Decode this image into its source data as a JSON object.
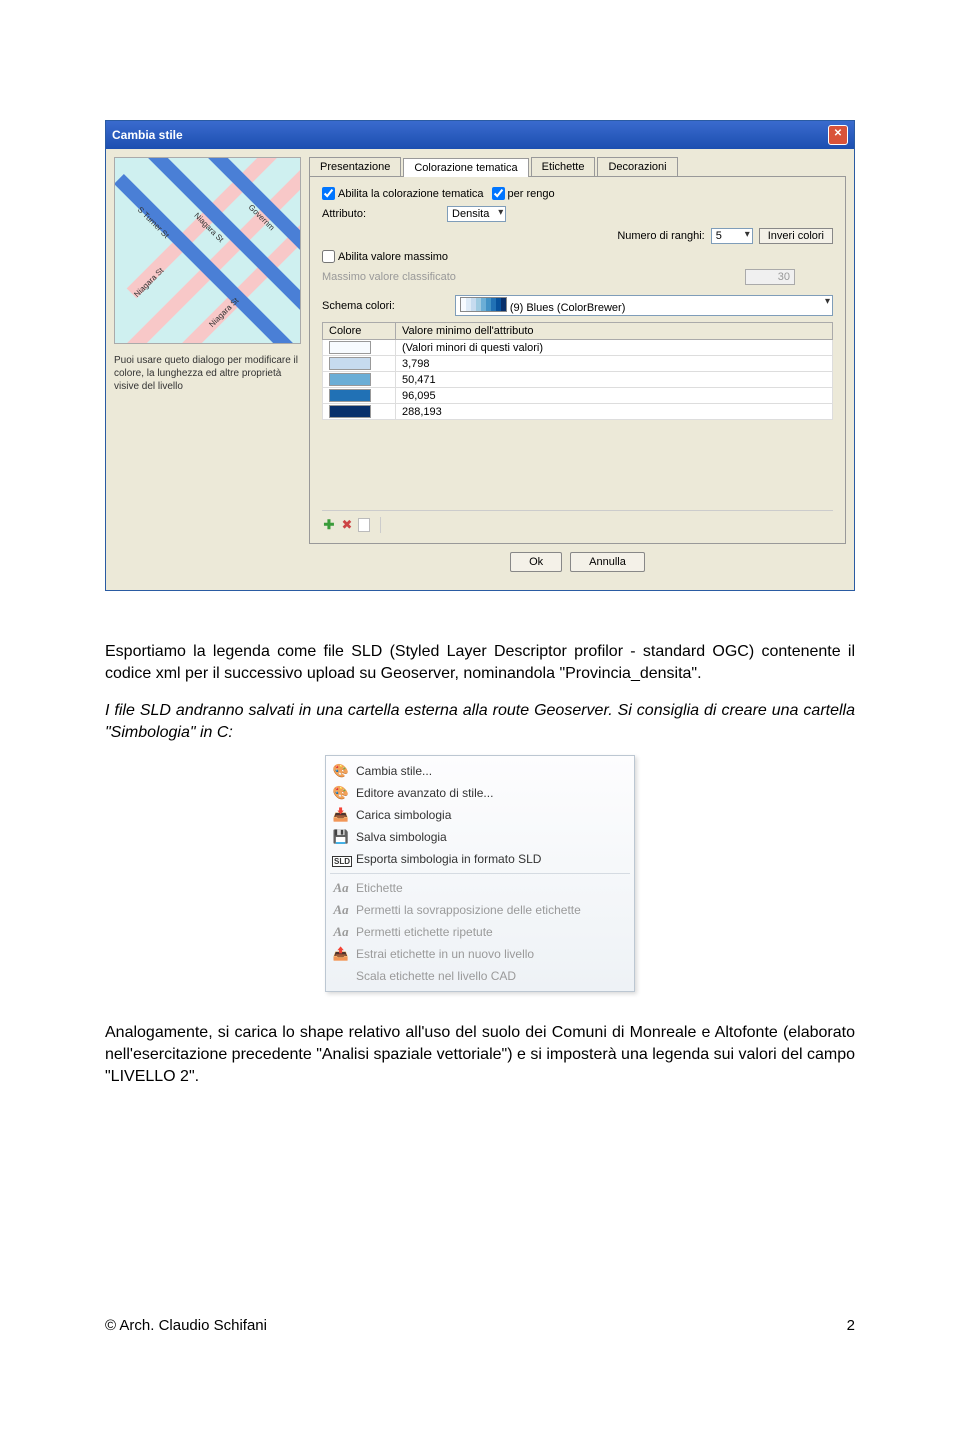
{
  "dialog": {
    "title": "Cambia stile",
    "help": "Puoi usare queto dialogo per modificare il colore, la lunghezza ed altre proprietà visive del livello",
    "tabs": [
      "Presentazione",
      "Colorazione tematica",
      "Etichette",
      "Decorazioni"
    ],
    "active_tab": 1,
    "enable_thematic": "Abilita la colorazione tematica",
    "per_range": "per rengo",
    "attr_label": "Attributo:",
    "attr_value": "Densita",
    "num_ranks_label": "Numero di ranghi:",
    "num_ranks_value": "5",
    "invert_colors": "Inveri colori",
    "enable_max": "Abilita valore massimo",
    "max_label": "Massimo valore classificato",
    "max_value": "30",
    "scheme_label": "Schema colori:",
    "scheme_value": "(9) Blues (ColorBrewer)",
    "col_header_color": "Colore",
    "col_header_min": "Valore minimo dell'attributo",
    "rows": [
      {
        "swatch": "#f7fbff",
        "label": "(Valori minori di questi valori)"
      },
      {
        "swatch": "#c6dbef",
        "label": "3,798"
      },
      {
        "swatch": "#6baed6",
        "label": "50,471"
      },
      {
        "swatch": "#2171b5",
        "label": "96,095"
      },
      {
        "swatch": "#08306b",
        "label": "288,193"
      }
    ],
    "ok": "Ok",
    "cancel": "Annulla",
    "map_labels": [
      "S Turner St",
      "Niagara St",
      "Governm"
    ]
  },
  "para1": "Esportiamo la legenda come file SLD (Styled Layer Descriptor profilor - standard OGC) contenente il codice xml per il successivo upload su Geoserver, nominandola \"Provincia_densita\".",
  "para2": "I file SLD andranno salvati in una cartella esterna alla route Geoserver. Si consiglia di creare una cartella \"Simbologia\" in C:",
  "menu": {
    "items": [
      {
        "icon": "🎨",
        "label": "Cambia stile...",
        "disabled": false
      },
      {
        "icon": "🎨",
        "label": "Editore avanzato di stile...",
        "disabled": false
      },
      {
        "icon": "📥",
        "label": "Carica simbologia",
        "disabled": false
      },
      {
        "icon": "💾",
        "label": "Salva simbologia",
        "disabled": false
      },
      {
        "icon": "SLD",
        "label": "Esporta simbologia in formato SLD",
        "disabled": false,
        "sld": true
      },
      {
        "sep": true
      },
      {
        "icon": "Aa",
        "label": "Etichette",
        "disabled": true,
        "aa": true
      },
      {
        "icon": "Aa",
        "label": "Permetti la sovrapposizione delle etichette",
        "disabled": true,
        "aa": true
      },
      {
        "icon": "Aa",
        "label": "Permetti etichette ripetute",
        "disabled": true,
        "aa": true
      },
      {
        "icon": "📤",
        "label": "Estrai etichette in un nuovo livello",
        "disabled": true
      },
      {
        "icon": "",
        "label": "Scala etichette nel livello CAD",
        "disabled": true
      }
    ]
  },
  "para3": "Analogamente, si carica lo shape relativo all'uso del suolo dei Comuni di Monreale e Altofonte (elaborato nell'esercitazione precedente \"Analisi spaziale vettoriale\") e si imposterà una legenda sui valori del campo \"LIVELLO 2\".",
  "footer_left": "© Arch. Claudio Schifani",
  "footer_right": "2"
}
